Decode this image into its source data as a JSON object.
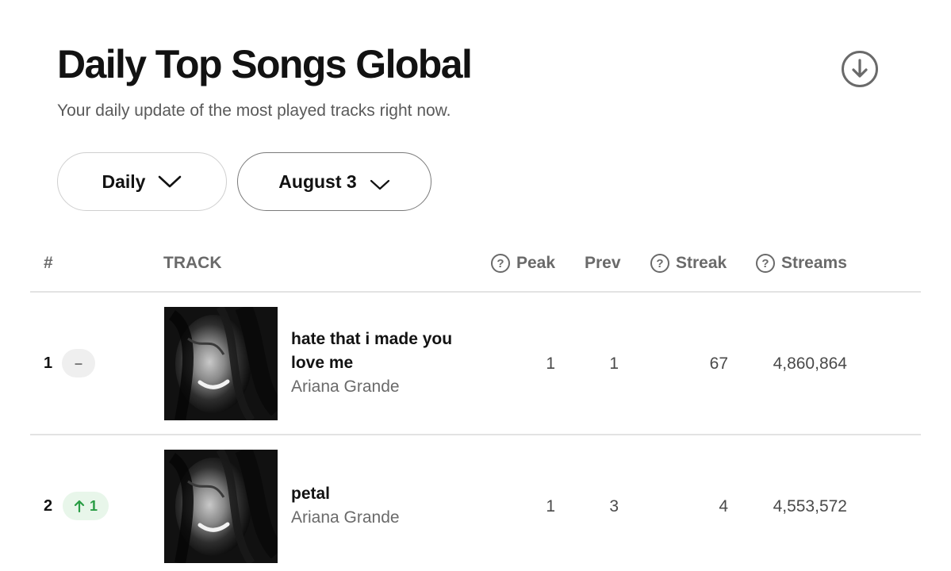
{
  "header": {
    "title": "Daily Top Songs Global",
    "subtitle": "Your daily update of the most played tracks right now.",
    "download_icon": "download-circle-icon"
  },
  "filters": {
    "frequency": "Daily",
    "date": "August 3"
  },
  "table": {
    "columns": {
      "rank": "#",
      "track": "TRACK",
      "peak": "Peak",
      "prev": "Prev",
      "streak": "Streak",
      "streams": "Streams"
    },
    "rows": [
      {
        "rank": "1",
        "movement": "–",
        "movement_type": "same",
        "title": "hate that i made you love me",
        "artist": "Ariana Grande",
        "peak": "1",
        "prev": "1",
        "streak": "67",
        "streams": "4,860,864"
      },
      {
        "rank": "2",
        "movement": "1",
        "movement_type": "up",
        "title": "petal",
        "artist": "Ariana Grande",
        "peak": "1",
        "prev": "3",
        "streak": "4",
        "streams": "4,553,572"
      }
    ]
  },
  "colors": {
    "up": "#2a9d45",
    "up_bg": "#e8f6ea",
    "muted": "#6a6a6a"
  }
}
